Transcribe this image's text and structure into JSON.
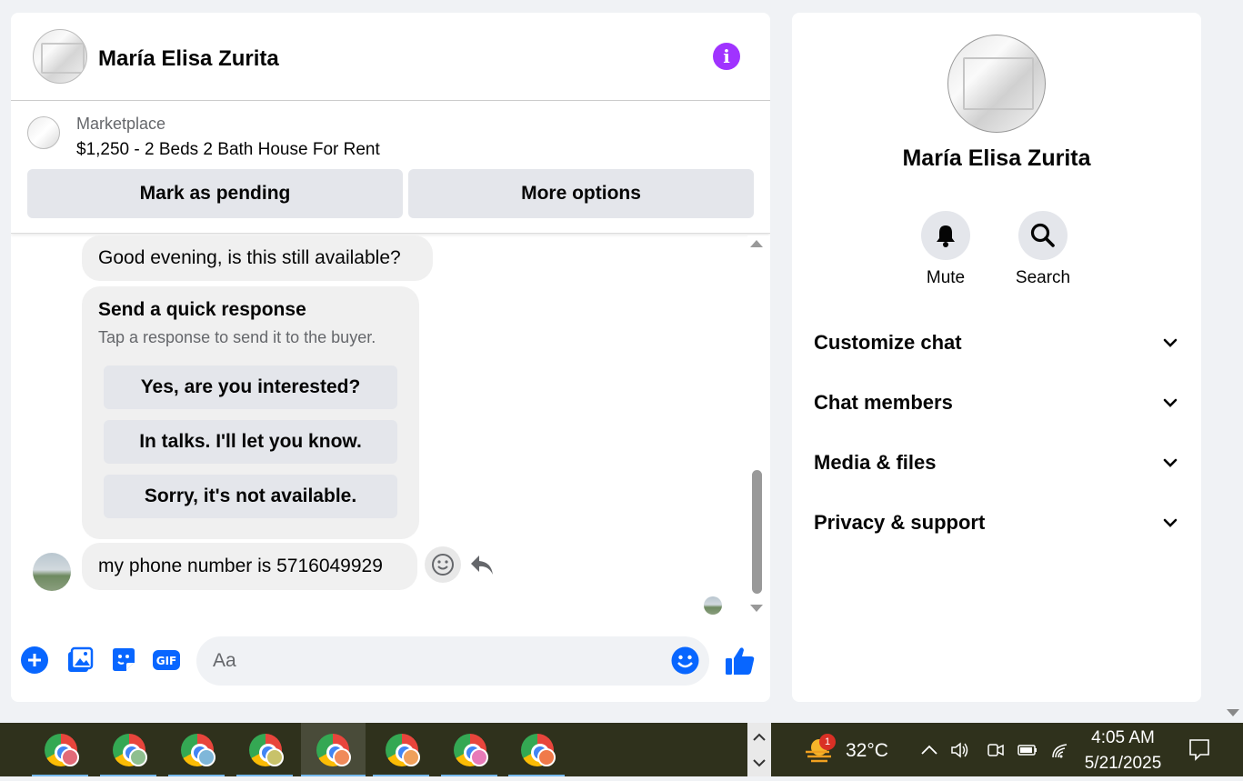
{
  "chat": {
    "contact_name": "María Elisa Zurita",
    "listing": {
      "source": "Marketplace",
      "title": "$1,250 - 2 Beds 2 Bath House For Rent",
      "mark_pending_label": "Mark as pending",
      "more_options_label": "More options"
    },
    "messages": [
      {
        "text": "Good evening, is this still available?",
        "from": "buyer"
      },
      {
        "text": "my phone number is 5716049929",
        "from": "buyer"
      }
    ],
    "quick_response": {
      "title": "Send a quick response",
      "subtitle": "Tap a response to send it to the buyer.",
      "options": [
        "Yes, are you interested?",
        "In talks. I'll let you know.",
        "Sorry, it's not available."
      ]
    },
    "composer": {
      "placeholder": "Aa"
    },
    "colors": {
      "accent": "#0866ff",
      "info": "#a033ff",
      "bubble": "#f0f0f0"
    }
  },
  "details": {
    "name": "María Elisa Zurita",
    "actions": [
      {
        "label": "Mute",
        "icon": "bell-icon"
      },
      {
        "label": "Search",
        "icon": "search-icon"
      }
    ],
    "sections": [
      "Customize chat",
      "Chat members",
      "Media & files",
      "Privacy & support"
    ]
  },
  "taskbar": {
    "app_count": 8,
    "active_index": 4,
    "weather": {
      "temp": "32°C",
      "badge": "1"
    },
    "clock": {
      "time": "4:05 AM",
      "date": "5/21/2025"
    }
  }
}
